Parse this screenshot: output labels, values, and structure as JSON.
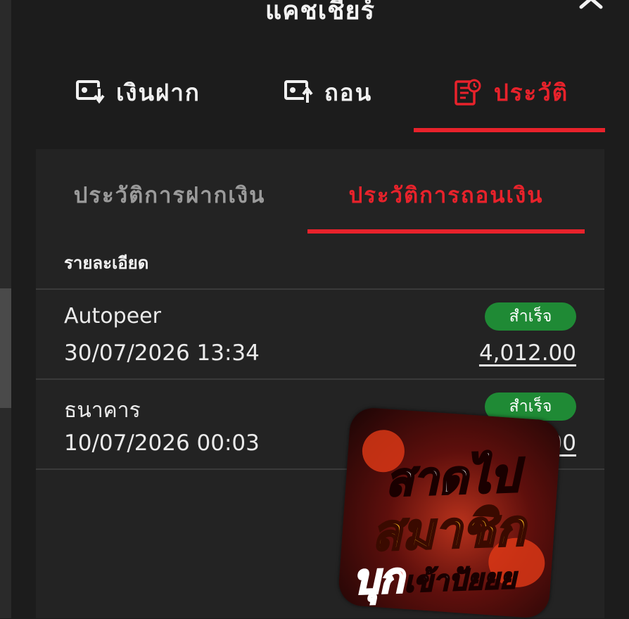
{
  "header": {
    "title": "แคชเชียร์",
    "close_icon": "close-icon"
  },
  "main_tabs": [
    {
      "label": "เงินฝาก",
      "icon": "deposit-icon",
      "active": false
    },
    {
      "label": "ถอน",
      "icon": "withdraw-icon",
      "active": false
    },
    {
      "label": "ประวัติ",
      "icon": "history-icon",
      "active": true
    }
  ],
  "sub_tabs": [
    {
      "label": "ประวัติการฝากเงิน",
      "active": false
    },
    {
      "label": "ประวัติการถอนเงิน",
      "active": true
    }
  ],
  "list": {
    "header": "รายละเอียด",
    "rows": [
      {
        "method": "Autopeer",
        "datetime": "30/07/2026 13:34",
        "status": "สำเร็จ",
        "amount": "4,012.00"
      },
      {
        "method": "ธนาคาร",
        "datetime": "10/07/2026 00:03",
        "status": "สำเร็จ",
        "amount": "00"
      }
    ]
  },
  "promo": {
    "line1": "สาดไป",
    "line2": "สมาชิก",
    "line3": "บุก",
    "line4": "เข้าปัยยย"
  },
  "colors": {
    "accent": "#e8222b",
    "success": "#1f8a35",
    "background": "#1c1c1c",
    "panel": "#232323"
  }
}
